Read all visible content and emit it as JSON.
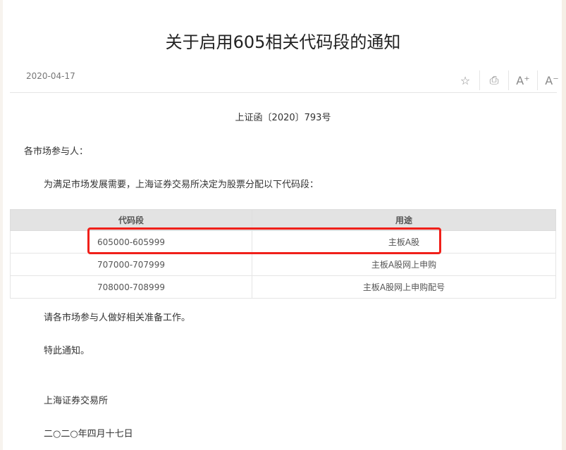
{
  "title": "关于启用605相关代码段的通知",
  "date": "2020-04-17",
  "toolbar": {
    "favorite": "☆",
    "print": "⎙",
    "font_increase": "A⁺",
    "font_decrease": "A⁻"
  },
  "doc_number": "上证函〔2020〕793号",
  "salutation": "各市场参与人：",
  "intro": "为满足市场发展需要，上海证券交易所决定为股票分配以下代码段：",
  "table": {
    "headers": [
      "代码段",
      "用途"
    ],
    "rows": [
      [
        "605000-605999",
        "主板A股"
      ],
      [
        "707000-707999",
        "主板A股网上申购"
      ],
      [
        "708000-708999",
        "主板A股网上申购配号"
      ]
    ]
  },
  "request": "请各市场参与人做好相关准备工作。",
  "closing": "特此通知。",
  "signer": "上海证券交易所",
  "sign_date": "二○二○年四月十七日"
}
